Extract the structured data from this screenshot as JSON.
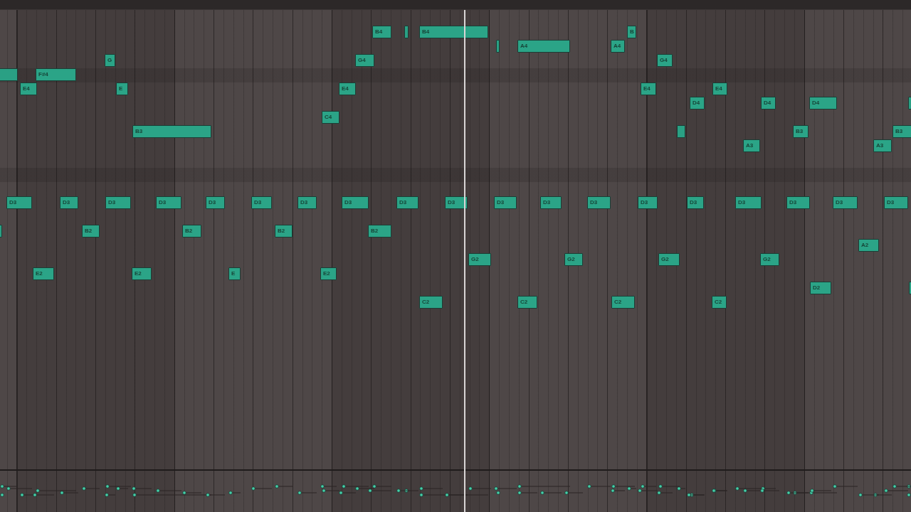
{
  "piano_roll": {
    "notes": [
      {
        "kind": "labeled",
        "label": "B4"
      },
      {
        "kind": "blank"
      },
      {
        "kind": "labeled",
        "label": "B4"
      },
      {
        "kind": "labeled",
        "label": "B"
      },
      {
        "kind": "blank"
      },
      {
        "kind": "labeled",
        "label": "A4"
      },
      {
        "kind": "labeled",
        "label": "A4"
      },
      {
        "kind": "labeled",
        "label": "G"
      },
      {
        "kind": "labeled",
        "label": "G4"
      },
      {
        "kind": "labeled",
        "label": "G4"
      },
      {
        "kind": "blank"
      },
      {
        "kind": "labeled",
        "label": "F#4"
      },
      {
        "kind": "labeled",
        "label": "E4"
      },
      {
        "kind": "labeled",
        "label": "E"
      },
      {
        "kind": "labeled",
        "label": "E4"
      },
      {
        "kind": "labeled",
        "label": "E4"
      },
      {
        "kind": "labeled",
        "label": "E4"
      },
      {
        "kind": "labeled",
        "label": "D4"
      },
      {
        "kind": "labeled",
        "label": "D4"
      },
      {
        "kind": "labeled",
        "label": "D4"
      },
      {
        "kind": "blank"
      },
      {
        "kind": "labeled",
        "label": "C4"
      },
      {
        "kind": "labeled",
        "label": "B3"
      },
      {
        "kind": "blank"
      },
      {
        "kind": "labeled",
        "label": "B3"
      },
      {
        "kind": "labeled",
        "label": "B3"
      },
      {
        "kind": "labeled",
        "label": "A3"
      },
      {
        "kind": "labeled",
        "label": "A3"
      },
      {
        "kind": "labeled",
        "label": "D3"
      },
      {
        "kind": "labeled",
        "label": "D3"
      },
      {
        "kind": "labeled",
        "label": "D3"
      },
      {
        "kind": "labeled",
        "label": "D3"
      },
      {
        "kind": "labeled",
        "label": "D3"
      },
      {
        "kind": "labeled",
        "label": "D3"
      },
      {
        "kind": "labeled",
        "label": "D3"
      },
      {
        "kind": "labeled",
        "label": "D3"
      },
      {
        "kind": "labeled",
        "label": "D3"
      },
      {
        "kind": "labeled",
        "label": "D3"
      },
      {
        "kind": "labeled",
        "label": "D3"
      },
      {
        "kind": "labeled",
        "label": "D3"
      },
      {
        "kind": "labeled",
        "label": "D3"
      },
      {
        "kind": "labeled",
        "label": "D3"
      },
      {
        "kind": "labeled",
        "label": "D3"
      },
      {
        "kind": "labeled",
        "label": "D3"
      },
      {
        "kind": "labeled",
        "label": "D3"
      },
      {
        "kind": "labeled",
        "label": "D3"
      },
      {
        "kind": "labeled",
        "label": "D3"
      },
      {
        "kind": "blank"
      },
      {
        "kind": "labeled",
        "label": "B2"
      },
      {
        "kind": "labeled",
        "label": "B2"
      },
      {
        "kind": "labeled",
        "label": "B2"
      },
      {
        "kind": "labeled",
        "label": "B2"
      },
      {
        "kind": "labeled",
        "label": "A2"
      },
      {
        "kind": "labeled",
        "label": "G2"
      },
      {
        "kind": "labeled",
        "label": "G2"
      },
      {
        "kind": "labeled",
        "label": "G2"
      },
      {
        "kind": "labeled",
        "label": "G2"
      },
      {
        "kind": "labeled",
        "label": "E2"
      },
      {
        "kind": "labeled",
        "label": "E2"
      },
      {
        "kind": "labeled",
        "label": "E"
      },
      {
        "kind": "labeled",
        "label": "E2"
      },
      {
        "kind": "labeled",
        "label": "D2"
      },
      {
        "kind": "blank"
      },
      {
        "kind": "labeled",
        "label": "C2"
      },
      {
        "kind": "labeled",
        "label": "C2"
      },
      {
        "kind": "labeled",
        "label": "C2"
      },
      {
        "kind": "labeled",
        "label": "C2"
      }
    ]
  }
}
